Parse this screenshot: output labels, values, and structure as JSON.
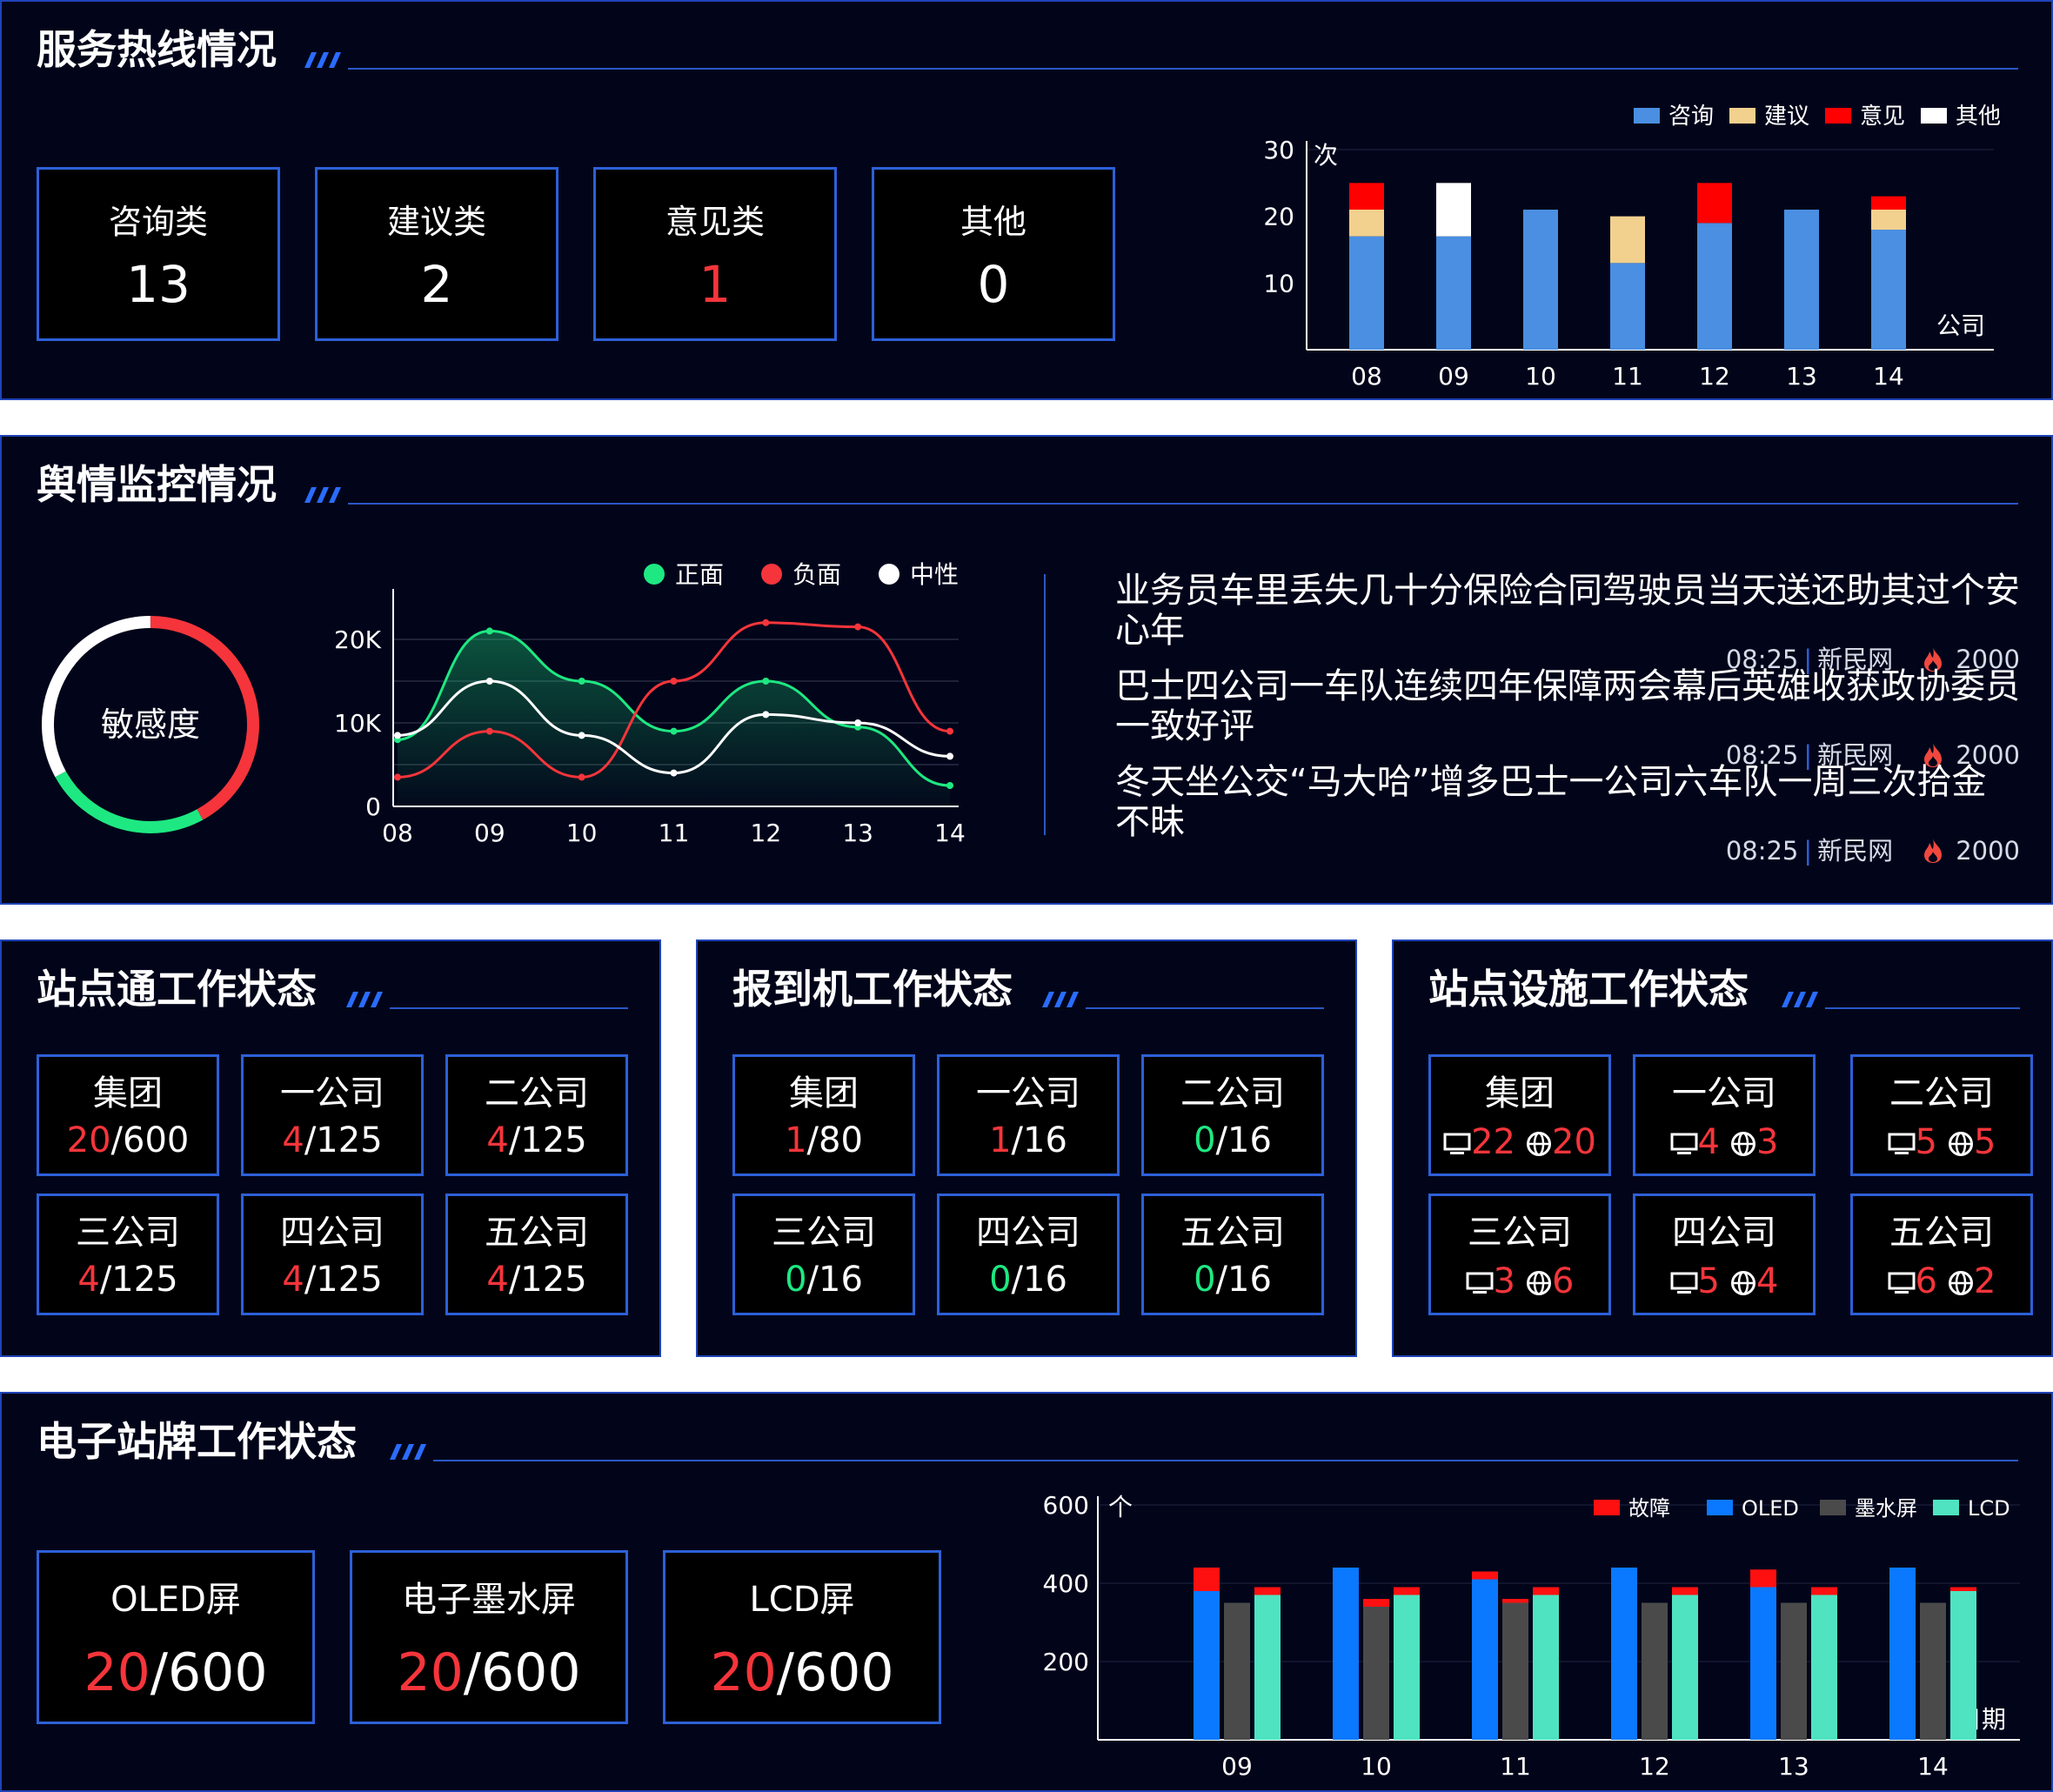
{
  "hotline": {
    "title": "服务热线情况",
    "stats": [
      {
        "label": "咨询类",
        "value": "13"
      },
      {
        "label": "建议类",
        "value": "2"
      },
      {
        "label": "意见类",
        "value": "1"
      },
      {
        "label": "其他",
        "value": "0"
      }
    ],
    "chart_data": {
      "type": "bar",
      "stacked": true,
      "categories": [
        "08",
        "09",
        "10",
        "11",
        "12",
        "13",
        "14"
      ],
      "series": [
        {
          "name": "咨询",
          "color": "#4a8fe2",
          "values": [
            17,
            17,
            21,
            13,
            19,
            21,
            18
          ]
        },
        {
          "name": "建议",
          "color": "#f2d08e",
          "values": [
            4,
            0,
            0,
            7,
            0,
            0,
            3
          ]
        },
        {
          "name": "意见",
          "color": "#ff0000",
          "values": [
            4,
            0,
            0,
            0,
            6,
            0,
            2
          ]
        },
        {
          "name": "其他",
          "color": "#ffffff",
          "values": [
            0,
            8,
            0,
            0,
            0,
            0,
            0
          ]
        }
      ],
      "ylim": [
        0,
        30
      ],
      "yticks": [
        "10",
        "20",
        "30"
      ],
      "yunit": "次",
      "xunit": "公司",
      "legend": "top-right"
    }
  },
  "opinion": {
    "title": "舆情监控情况",
    "gauge_label": "敏感度",
    "gauge": {
      "white": 0.33,
      "red": 0.42,
      "green": 0.25
    },
    "chart_data": {
      "type": "line",
      "categories": [
        "08",
        "09",
        "10",
        "11",
        "12",
        "13",
        "14"
      ],
      "ylim": [
        0,
        25000
      ],
      "yticks": [
        "0",
        "10K",
        "20K"
      ],
      "series": [
        {
          "name": "正面",
          "color": "#1ee882",
          "values": [
            8000,
            21000,
            15000,
            9000,
            15000,
            9500,
            2500
          ]
        },
        {
          "name": "负面",
          "color": "#f5353b",
          "values": [
            3500,
            9000,
            3500,
            15000,
            22000,
            21500,
            9000
          ]
        },
        {
          "name": "中性",
          "color": "#ffffff",
          "values": [
            8500,
            15000,
            8500,
            4000,
            11000,
            10000,
            6000
          ]
        }
      ],
      "legend": "top-right"
    },
    "news": [
      {
        "title": "业务员车里丢失几十分保险合同驾驶员当天送还助其过个安心年",
        "time": "08:25",
        "source": "新民网",
        "heat": "2000"
      },
      {
        "title": "巴士四公司一车队连续四年保障两会幕后英雄收获政协委员一致好评",
        "time": "08:25",
        "source": "新民网",
        "heat": "2000"
      },
      {
        "title": "冬天坐公交“马大哈”增多巴士一公司六车队一周三次拾金不昧",
        "time": "08:25",
        "source": "新民网",
        "heat": "2000"
      }
    ]
  },
  "station_app": {
    "title": "站点通工作状态",
    "items": [
      {
        "label": "集团",
        "cur": "20",
        "total": "/600"
      },
      {
        "label": "一公司",
        "cur": "4",
        "total": "/125"
      },
      {
        "label": "二公司",
        "cur": "4",
        "total": "/125"
      },
      {
        "label": "三公司",
        "cur": "4",
        "total": "/125"
      },
      {
        "label": "四公司",
        "cur": "4",
        "total": "/125"
      },
      {
        "label": "五公司",
        "cur": "4",
        "total": "/125"
      }
    ]
  },
  "checkin": {
    "title": "报到机工作状态",
    "items": [
      {
        "label": "集团",
        "cur": "1",
        "total": "/80"
      },
      {
        "label": "一公司",
        "cur": "1",
        "total": "/16"
      },
      {
        "label": "二公司",
        "cur": "0",
        "total": "/16"
      },
      {
        "label": "三公司",
        "cur": "0",
        "total": "/16"
      },
      {
        "label": "四公司",
        "cur": "0",
        "total": "/16"
      },
      {
        "label": "五公司",
        "cur": "0",
        "total": "/16"
      }
    ]
  },
  "facility": {
    "title": "站点设施工作状态",
    "items": [
      {
        "label": "集团",
        "monitor": "22",
        "net": "20"
      },
      {
        "label": "一公司",
        "monitor": "4",
        "net": "3"
      },
      {
        "label": "二公司",
        "monitor": "5",
        "net": "5"
      },
      {
        "label": "三公司",
        "monitor": "3",
        "net": "6"
      },
      {
        "label": "四公司",
        "monitor": "5",
        "net": "4"
      },
      {
        "label": "五公司",
        "monitor": "6",
        "net": "2"
      }
    ]
  },
  "esign": {
    "title": "电子站牌工作状态",
    "stats": [
      {
        "label": "OLED屏",
        "cur": "20",
        "total": "/600"
      },
      {
        "label": "电子墨水屏",
        "cur": "20",
        "total": "/600"
      },
      {
        "label": "LCD屏",
        "cur": "20",
        "total": "/600"
      }
    ],
    "chart_data": {
      "type": "bar",
      "categories": [
        "09",
        "10",
        "11",
        "12",
        "13",
        "14"
      ],
      "ylim": [
        0,
        600
      ],
      "yticks": [
        "200",
        "400",
        "600"
      ],
      "yunit": "个",
      "xunit": "日期",
      "fault_name": "故障",
      "fault_color": "#ff1010",
      "series": [
        {
          "name": "OLED",
          "color": "#0a78ff",
          "values": [
            380,
            440,
            410,
            440,
            390,
            440
          ],
          "fault": [
            60,
            0,
            20,
            0,
            45,
            0
          ]
        },
        {
          "name": "墨水屏",
          "color": "#4a4a4a",
          "values": [
            350,
            340,
            350,
            350,
            350,
            350
          ],
          "fault": [
            0,
            20,
            10,
            0,
            0,
            0
          ]
        },
        {
          "name": "LCD",
          "color": "#4fe3c1",
          "values": [
            370,
            370,
            370,
            370,
            370,
            380
          ],
          "fault": [
            20,
            20,
            20,
            20,
            20,
            10
          ]
        }
      ],
      "legend": "top-right"
    }
  }
}
